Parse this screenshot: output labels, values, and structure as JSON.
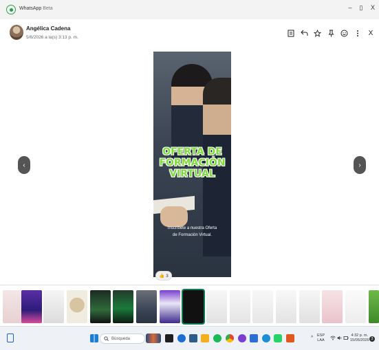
{
  "window": {
    "app_name": "WhatsApp",
    "app_suffix": "Beta",
    "controls": {
      "minimize": "–",
      "maximize": "▯",
      "close": "X"
    }
  },
  "header": {
    "sender": "Angélica Cadena",
    "timestamp": "5/6/2026 a la(s) 3:13 p. m.",
    "actions": [
      "list-icon",
      "reply-icon",
      "star-icon",
      "pin-icon",
      "emoji-icon",
      "more-icon",
      "close-icon"
    ],
    "close_label": "X"
  },
  "viewer": {
    "prev_label": "‹",
    "next_label": "›",
    "overlay_title_lines": [
      "OFERTA DE",
      "FORMACIÓN",
      "VIRTUAL"
    ],
    "overlay_subtitle_lines": [
      "Inscríbete a nuestra Oferta",
      "de Formación Virtual."
    ],
    "reaction_emoji": "👍",
    "reaction_count": "3"
  },
  "taskbar": {
    "search_placeholder": "Búsqueda",
    "language_top": "ESP",
    "language_bottom": "LAA",
    "time": "4:32 p. m.",
    "date": "15/05/2026",
    "notification_count": "3",
    "tray_chevron": "^"
  },
  "colors": {
    "accent": "#25a244",
    "overlay_text": "#7ddc3a",
    "nav_button": "#555555",
    "selected_thumb": "#0f7a5a"
  }
}
